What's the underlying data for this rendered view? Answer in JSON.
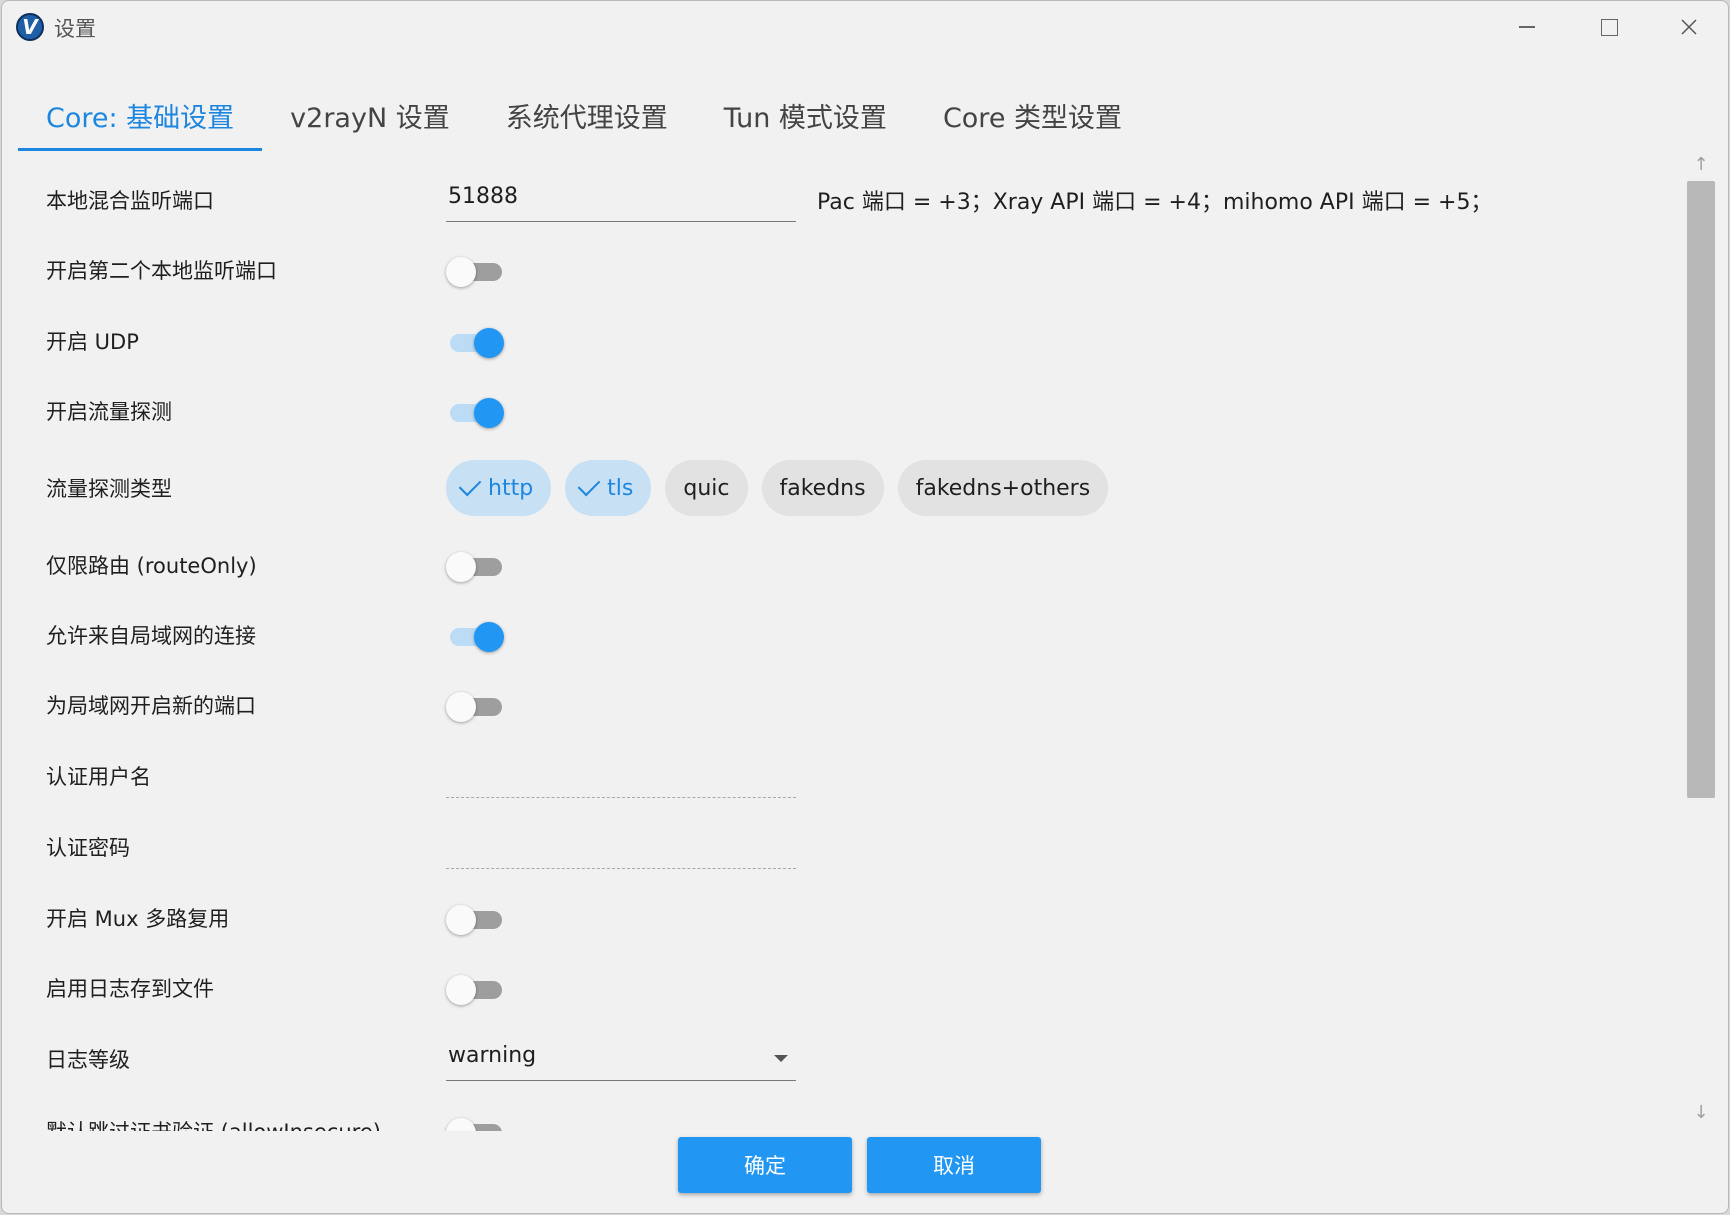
{
  "window": {
    "title": "设置",
    "app_icon_letter": "V"
  },
  "tabs": [
    {
      "label": "Core: 基础设置",
      "active": true
    },
    {
      "label": "v2rayN 设置",
      "active": false
    },
    {
      "label": "系统代理设置",
      "active": false
    },
    {
      "label": "Tun 模式设置",
      "active": false
    },
    {
      "label": "Core 类型设置",
      "active": false
    }
  ],
  "settings": {
    "local_port": {
      "label": "本地混合监听端口",
      "value": "51888",
      "hint": "Pac 端口 = +3；Xray API 端口 = +4；mihomo API 端口 = +5；"
    },
    "second_port": {
      "label": "开启第二个本地监听端口",
      "on": false
    },
    "udp": {
      "label": "开启 UDP",
      "on": true
    },
    "sniffing": {
      "label": "开启流量探测",
      "on": true
    },
    "sniffing_types": {
      "label": "流量探测类型",
      "options": [
        {
          "label": "http",
          "selected": true
        },
        {
          "label": "tls",
          "selected": true
        },
        {
          "label": "quic",
          "selected": false
        },
        {
          "label": "fakedns",
          "selected": false
        },
        {
          "label": "fakedns+others",
          "selected": false
        }
      ]
    },
    "route_only": {
      "label": "仅限路由 (routeOnly)",
      "on": false
    },
    "allow_lan": {
      "label": "允许来自局域网的连接",
      "on": true
    },
    "new_lan_port": {
      "label": "为局域网开启新的端口",
      "on": false
    },
    "auth_user": {
      "label": "认证用户名",
      "value": ""
    },
    "auth_pass": {
      "label": "认证密码",
      "value": ""
    },
    "mux": {
      "label": "开启 Mux 多路复用",
      "on": false
    },
    "log_to_file": {
      "label": "启用日志存到文件",
      "on": false
    },
    "log_level": {
      "label": "日志等级",
      "value": "warning"
    },
    "allow_insecure": {
      "label": "默认跳过证书验证 (allowInsecure)",
      "on": false
    }
  },
  "buttons": {
    "ok": "确定",
    "cancel": "取消"
  },
  "colors": {
    "accent": "#2196f3",
    "tab_active": "#1d86e0",
    "chip_selected_bg": "#c7e0f3"
  }
}
